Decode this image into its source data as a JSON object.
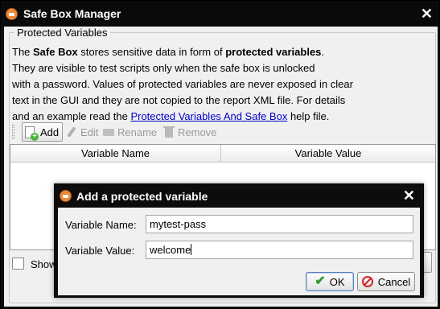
{
  "window": {
    "title": "Safe Box Manager",
    "close_symbol": "✕"
  },
  "group": {
    "legend": "Protected Variables"
  },
  "description": {
    "l1a": "The ",
    "l1b": "Safe Box",
    "l1c": " stores sensitive data in form of ",
    "l1d": "protected variables",
    "l1e": ".",
    "l2": "They are visible to test scripts only when the safe box is unlocked",
    "l3": "with a password. Values of protected variables are never exposed in clear",
    "l4": "text in the GUI and they are not copied to the report XML file. For details",
    "l5a": "and an example read the ",
    "l5link": "Protected Variables And Safe Box",
    "l5b": " help file."
  },
  "toolbar": {
    "add": "Add",
    "edit": "Edit",
    "rename": "Rename",
    "remove": "Remove"
  },
  "table": {
    "columns": [
      "Variable Name",
      "Variable Value"
    ]
  },
  "show_checkbox": {
    "label": "Show"
  },
  "dialog": {
    "title": "Add a protected variable",
    "close_symbol": "✕",
    "name_label": "Variable Name:",
    "name_value": "mytest-pass",
    "value_label": "Variable Value:",
    "value_value": "welcome",
    "ok": "OK",
    "cancel": "Cancel"
  },
  "colors": {
    "link": "#0000cc",
    "titlebar": "#0a0a0a",
    "ok_check": "#2e9a2e",
    "cancel_icon": "#d02525"
  },
  "icons": [
    "app-icon",
    "close-icon",
    "add-icon",
    "wrench-icon",
    "rename-icon",
    "trash-icon",
    "checkmark-icon",
    "cancel-icon"
  ]
}
